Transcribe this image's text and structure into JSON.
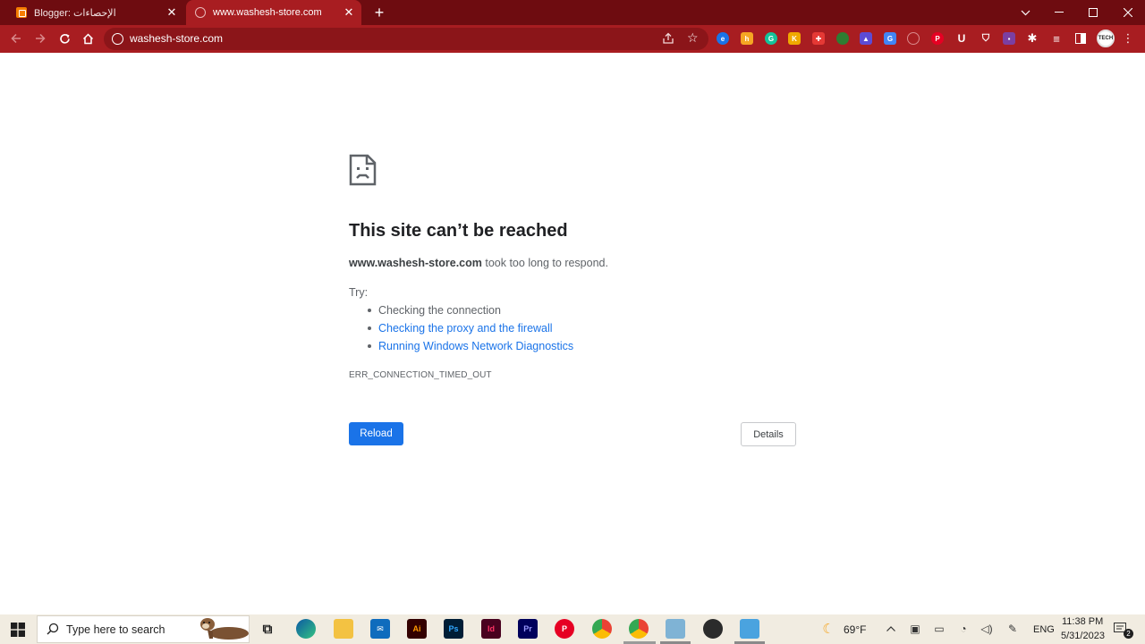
{
  "browser": {
    "tabs": [
      {
        "title": "Blogger: الإحصاءات",
        "favicon": "blogger-icon",
        "active": false
      },
      {
        "title": "www.washesh-store.com",
        "favicon": "globe-icon",
        "active": true
      }
    ],
    "address_bar": {
      "url": "washesh-store.com"
    },
    "theme_color": "#a81d21",
    "frame_color": "#6e0c10"
  },
  "error_page": {
    "title": "This site can’t be reached",
    "host": "www.washesh-store.com",
    "message": " took too long to respond.",
    "try_label": "Try:",
    "suggestions": [
      {
        "text": "Checking the connection",
        "is_link": false
      },
      {
        "text": "Checking the proxy and the firewall",
        "is_link": true
      },
      {
        "text": "Running Windows Network Diagnostics",
        "is_link": true
      }
    ],
    "error_code": "ERR_CONNECTION_TIMED_OUT",
    "reload_label": "Reload",
    "details_label": "Details",
    "link_color": "#1a73e8"
  },
  "extensions": [
    "e-ext-icon",
    "honey-ext-icon",
    "grammarly-ext-icon",
    "k-ext-icon",
    "red-ext-icon",
    "green-ext-icon",
    "purple-ext-icon",
    "translate-ext-icon",
    "blocked-ext-icon",
    "pinterest-ext-icon",
    "u-ext-icon",
    "shield-ext-icon",
    "purple-square-ext-icon",
    "puzzle-icon",
    "media-icon",
    "sidepanel-icon"
  ],
  "profile_label": "TECH",
  "taskbar": {
    "search_placeholder": "Type here to search",
    "apps": [
      "task-view-icon",
      "edge-icon",
      "file-explorer-icon",
      "mail-icon",
      "illustrator-icon",
      "photoshop-icon",
      "indesign-icon",
      "premiere-icon",
      "pinterest-icon",
      "chrome-icon",
      "chrome-profile-icon",
      "notepad-icon",
      "obs-icon",
      "remote-desktop-icon"
    ],
    "app_labels": {
      "illustrator": "Ai",
      "photoshop": "Ps",
      "indesign": "Id",
      "premiere": "Pr"
    },
    "weather": "69°F",
    "language": "ENG",
    "time": "11:38 PM",
    "date": "5/31/2023",
    "notification_count": "2"
  }
}
